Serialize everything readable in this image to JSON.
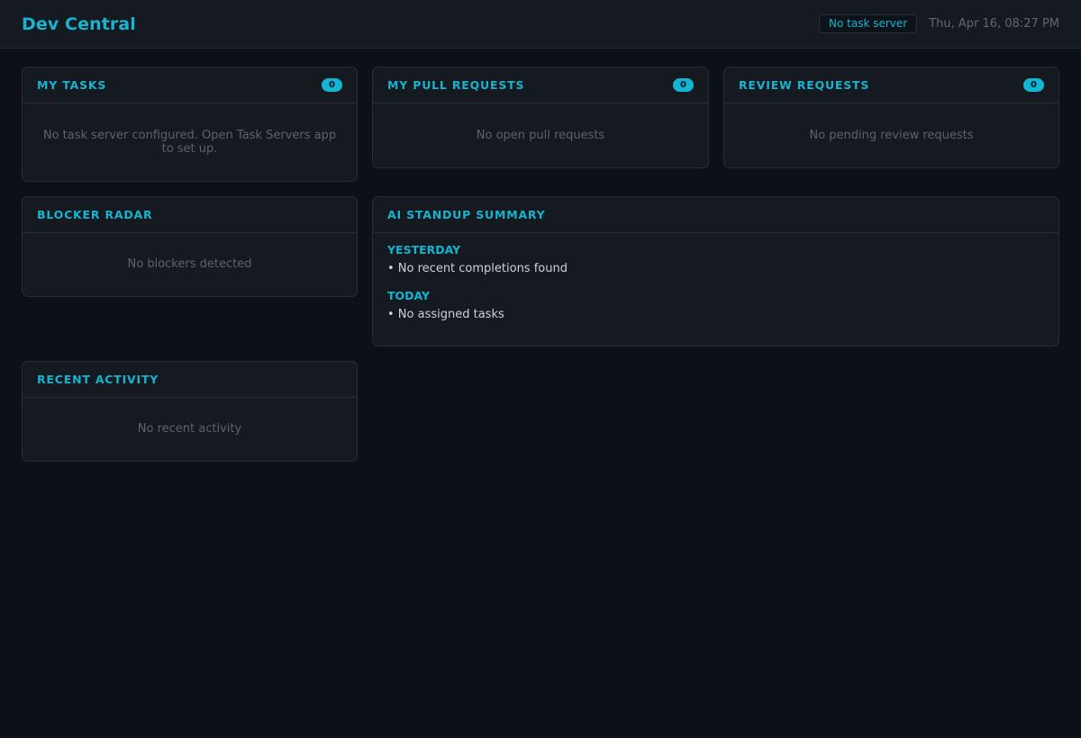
{
  "header": {
    "title": "Dev Central",
    "server_status": "No task server",
    "datetime": "Thu, Apr 16, 08:27 PM"
  },
  "cards": {
    "tasks": {
      "title": "MY TASKS",
      "count": "0",
      "empty": "No task server configured. Open Task Servers app to set up."
    },
    "prs": {
      "title": "MY PULL REQUESTS",
      "count": "0",
      "empty": "No open pull requests"
    },
    "reviews": {
      "title": "REVIEW REQUESTS",
      "count": "0",
      "empty": "No pending review requests"
    },
    "blockers": {
      "title": "BLOCKER RADAR",
      "empty": "No blockers detected"
    },
    "standup": {
      "title": "AI STANDUP SUMMARY",
      "yesterday_label": "YESTERDAY",
      "yesterday_item": "• No recent completions found",
      "today_label": "TODAY",
      "today_item": "• No assigned tasks"
    },
    "activity": {
      "title": "RECENT ACTIVITY",
      "empty": "No recent activity"
    }
  },
  "colors": {
    "accent": "#17b3cf",
    "background": "#0d1017",
    "card": "#151a21",
    "muted_text": "#5a626d"
  }
}
